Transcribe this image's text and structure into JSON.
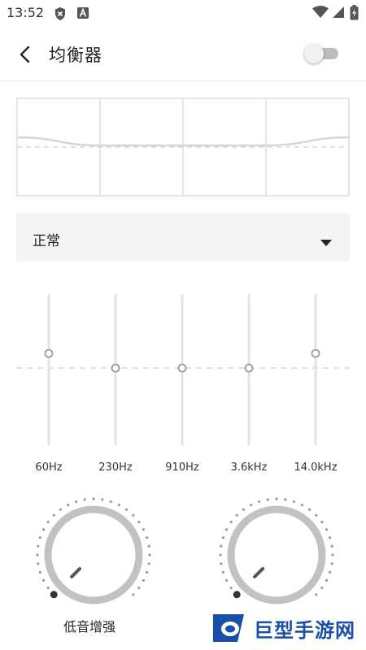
{
  "status_bar": {
    "time": "13:52",
    "icons": [
      "shield-x-icon",
      "font-a-icon",
      "wifi-icon",
      "signal-icon",
      "battery-charging-icon"
    ]
  },
  "header": {
    "back_icon": "chevron-left-icon",
    "title": "均衡器",
    "enabled": false
  },
  "curve": {
    "gains": [
      0.1,
      0.0,
      0.0,
      0.0,
      0.1
    ]
  },
  "preset": {
    "selected": "正常",
    "arrow_icon": "triangle-down-icon"
  },
  "bands": [
    {
      "label": "60Hz",
      "level": 0.1
    },
    {
      "label": "230Hz",
      "level": 0.0
    },
    {
      "label": "910Hz",
      "level": 0.0
    },
    {
      "label": "3.6kHz",
      "level": 0.0
    },
    {
      "label": "14.0kHz",
      "level": 0.1
    }
  ],
  "knobs": {
    "bass_label": "低音增强",
    "bass_level": 0.0,
    "virtualizer_level": 0.0
  },
  "watermark": {
    "text": "巨型手游网"
  },
  "colors": {
    "grid": "#dddddd",
    "curve": "#d6d6d6",
    "dashed": "#cfcfcf",
    "slider_track": "#e3e3e3",
    "knob_ring": "#c2c2c2",
    "dots": "#9a9a9a",
    "indicator": "#555555",
    "watermark": "#1a4fa8"
  }
}
